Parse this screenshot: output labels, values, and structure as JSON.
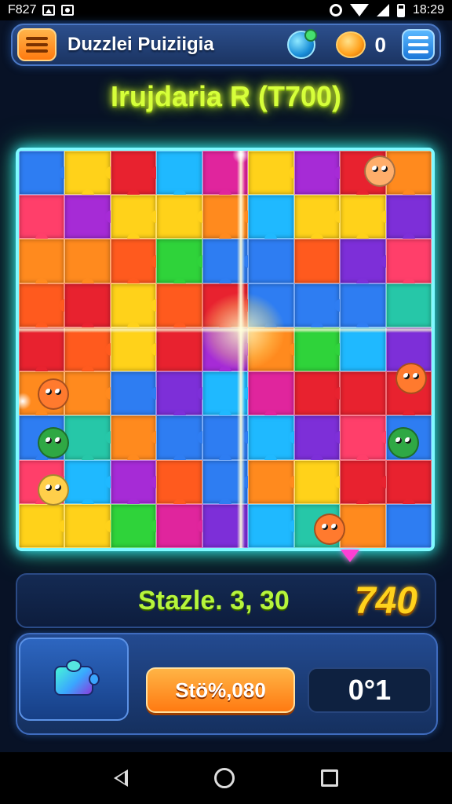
{
  "status_bar": {
    "left_text": "F827",
    "time": "18:29",
    "icons": [
      "picture-icon",
      "shop-icon",
      "sync-icon",
      "wifi-icon",
      "signal-icon",
      "battery-icon"
    ]
  },
  "top_bar": {
    "app_title": "Duzzlei Puiziigia",
    "coin_count": "0",
    "icons": [
      "left-menu-icon",
      "globe-chat-icon",
      "coin-icon",
      "menu-icon"
    ]
  },
  "level": {
    "title": "Irujdaria R (T700)"
  },
  "board": {
    "rows": 9,
    "cols": 9,
    "palette": [
      "#e8222f",
      "#ff8a1e",
      "#ffd21a",
      "#2fd33a",
      "#1fb9ff",
      "#2e7df2",
      "#a62bd6",
      "#e0259d",
      "#ff5a1e",
      "#7d2fd8",
      "#26c7a8",
      "#ff3f6a"
    ],
    "creatures": [
      "#ffae6b",
      "#ff7a2e",
      "#2fa844",
      "#ffcf4a",
      "#ff7a2e",
      "#2fa844",
      "#ff7a2e"
    ]
  },
  "score_panel": {
    "stage_text": "Stazle. 3,  30",
    "score": "740"
  },
  "action_panel": {
    "buy_label": "Stö%,080",
    "counter": "0°1"
  },
  "colors": {
    "accent": "#31e9ff",
    "title_green": "#d6ff3a",
    "score_gold": "#ffd21c",
    "button_orange": "#ff7a12"
  }
}
